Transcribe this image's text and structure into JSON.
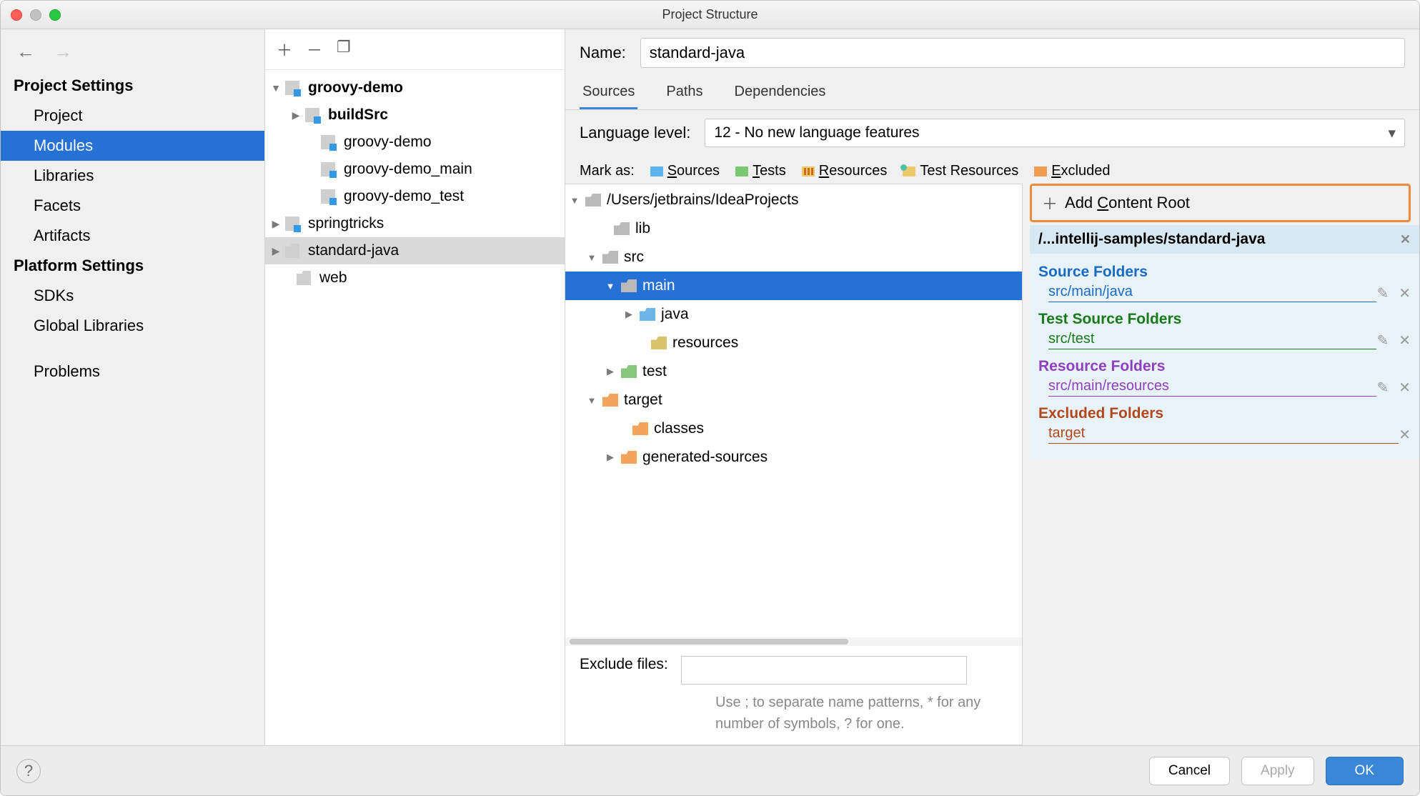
{
  "window": {
    "title": "Project Structure"
  },
  "sidebar": {
    "headings": {
      "project": "Project Settings",
      "platform": "Platform Settings"
    },
    "items": {
      "project": "Project",
      "modules": "Modules",
      "libraries": "Libraries",
      "facets": "Facets",
      "artifacts": "Artifacts",
      "sdks": "SDKs",
      "global_libraries": "Global Libraries",
      "problems": "Problems"
    }
  },
  "module_tree": {
    "groovy_demo": "groovy-demo",
    "buildSrc": "buildSrc",
    "gd": "groovy-demo",
    "gd_main": "groovy-demo_main",
    "gd_test": "groovy-demo_test",
    "springtricks": "springtricks",
    "standard_java": "standard-java",
    "web": "web"
  },
  "right": {
    "name_label": "Name:",
    "name_value": "standard-java",
    "tabs": {
      "sources": "Sources",
      "paths": "Paths",
      "deps": "Dependencies"
    },
    "lang_level_label": "Language level:",
    "lang_level_value": "12 - No new language features",
    "mark_as_label": "Mark as:",
    "mark": {
      "sources": "ources",
      "tests": "ests",
      "resources": "esources",
      "test_resources": "Test Resources",
      "excluded": "xcluded"
    },
    "tree": {
      "root": "/Users/jetbrains/IdeaProjects",
      "lib": "lib",
      "src": "src",
      "main": "main",
      "java": "java",
      "resources": "resources",
      "test": "test",
      "target": "target",
      "classes": "classes",
      "generated": "generated-sources"
    },
    "exclude_label": "Exclude files:",
    "exclude_help": "Use ; to separate name patterns, * for any number of symbols, ? for one.",
    "add_content_root": "Add Content Root",
    "content_root_path": "/...intellij-samples/standard-java",
    "sections": {
      "source_folders": "Source Folders",
      "src_main_java": "src/main/java",
      "test_source_folders": "Test Source Folders",
      "src_test": "src/test",
      "resource_folders": "Resource Folders",
      "src_main_resources": "src/main/resources",
      "excluded_folders": "Excluded Folders",
      "target": "target"
    }
  },
  "footer": {
    "cancel": "Cancel",
    "apply": "Apply",
    "ok": "OK"
  }
}
